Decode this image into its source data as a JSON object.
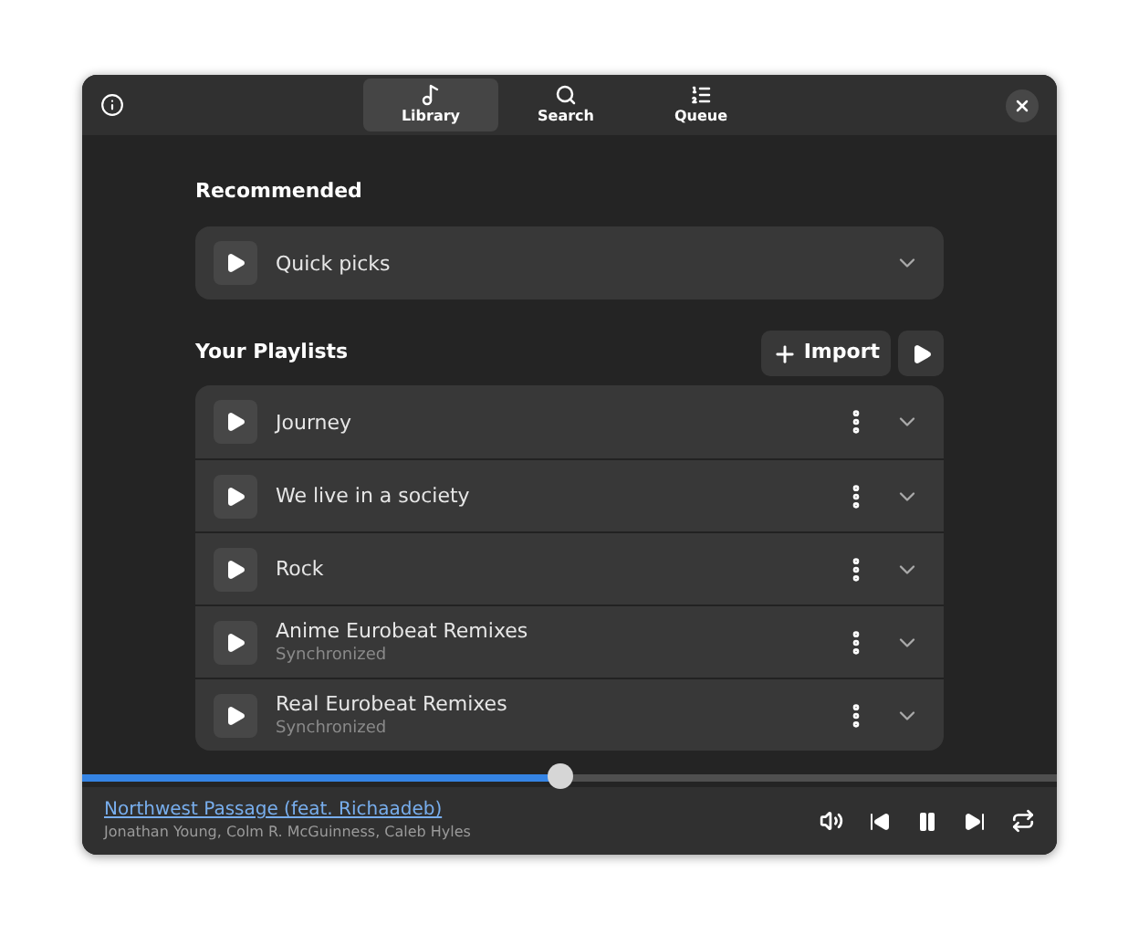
{
  "tabs": [
    {
      "label": "Library",
      "kind": "library",
      "selected": true
    },
    {
      "label": "Search",
      "kind": "search",
      "selected": false
    },
    {
      "label": "Queue",
      "kind": "queue",
      "selected": false
    }
  ],
  "recommended": {
    "title": "Recommended",
    "items": [
      {
        "name": "Quick picks"
      }
    ]
  },
  "playlists": {
    "title": "Your Playlists",
    "import_label": "Import",
    "items": [
      {
        "name": "Journey"
      },
      {
        "name": "We live in a society"
      },
      {
        "name": "Rock"
      },
      {
        "name": "Anime Eurobeat Remixes",
        "status": "Synchronized"
      },
      {
        "name": "Real Eurobeat Remixes",
        "status": "Synchronized"
      }
    ]
  },
  "player": {
    "level": 0.49,
    "title": "Northwest Passage (feat. Richaadeb)",
    "artists": "Jonathan Young, Colm R. McGuinness, Caleb Hyles",
    "playing": true
  }
}
